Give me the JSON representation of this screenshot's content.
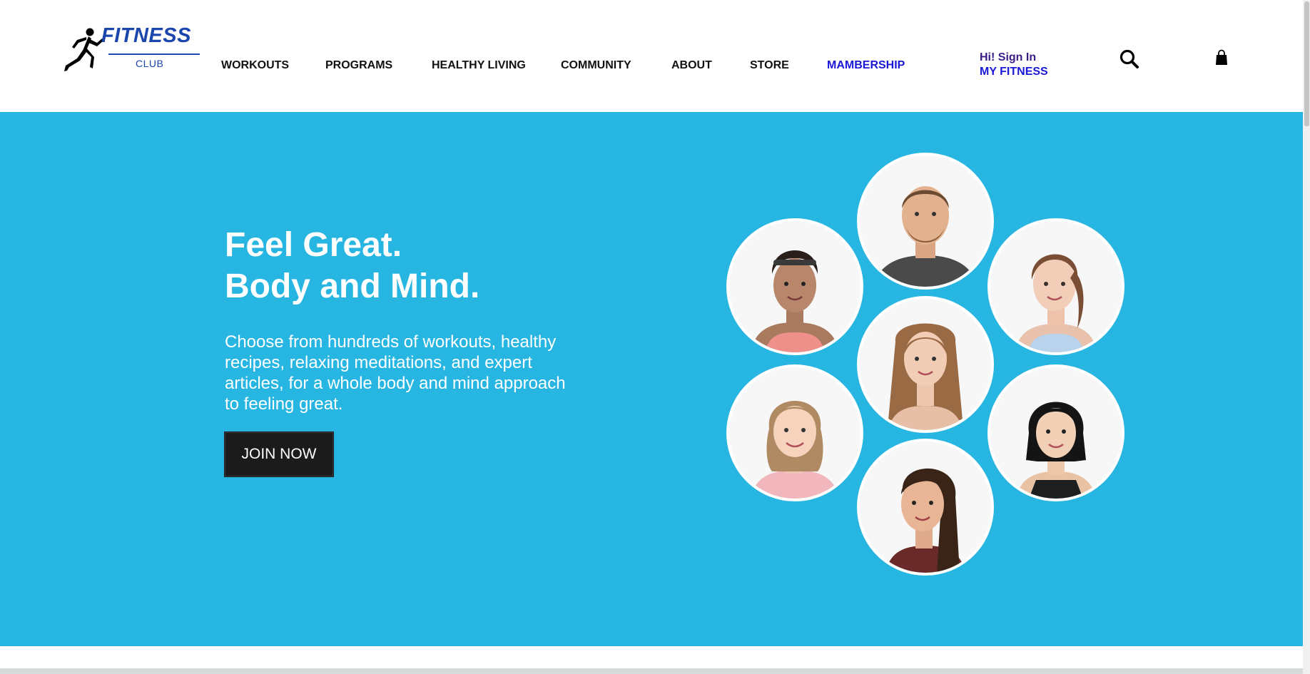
{
  "brand": {
    "name": "FITNESS",
    "sub": "CLUB"
  },
  "nav": {
    "items": [
      {
        "label": "WORKOUTS"
      },
      {
        "label": "PROGRAMS"
      },
      {
        "label": "HEALTHY LIVING"
      },
      {
        "label": "COMMUNITY"
      },
      {
        "label": "ABOUT"
      },
      {
        "label": "STORE"
      },
      {
        "label": "MAMBERSHIP"
      }
    ]
  },
  "account": {
    "line1": "Hi! Sign In",
    "line2": "MY FITNESS"
  },
  "icons": {
    "search": "search-icon",
    "cart": "shopping-bag-icon",
    "logo": "runner-icon"
  },
  "hero": {
    "title_line1": "Feel Great.",
    "title_line2": "Body and Mind.",
    "description": "Choose from hundreds of workouts, healthy recipes, relaxing meditations, and expert articles, for a whole body and mind approach to feeling great.",
    "cta": "JOIN NOW"
  },
  "colors": {
    "brand_blue": "#1a46ad",
    "hero_bg": "#27b5e1",
    "nav_accent": "#1a18d6",
    "button_bg": "#1b1b1b"
  }
}
